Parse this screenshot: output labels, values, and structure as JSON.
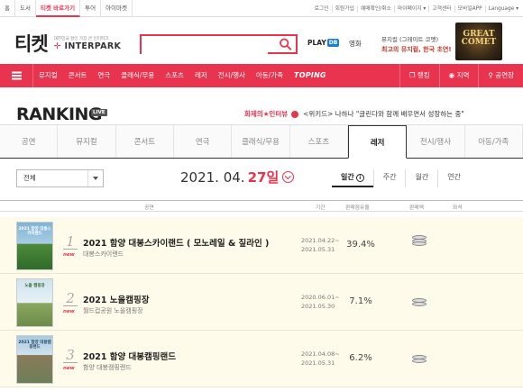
{
  "topbar": {
    "tabs": [
      {
        "label": "홈",
        "active": false
      },
      {
        "label": "도서",
        "active": false
      },
      {
        "label": "티켓 바로가기",
        "active": true
      },
      {
        "label": "투어",
        "active": false
      },
      {
        "label": "아이마켓",
        "active": false
      }
    ],
    "links": [
      "로그인",
      "회원가입",
      "예매확인/취소",
      "마이페이지 ▾",
      "고객센터",
      "모바일APP",
      "Language ▾"
    ]
  },
  "header": {
    "logo_kr": "티켓",
    "logo_small": "대한민국 할인 가장 큰 인터파크",
    "logo_en_prefix": "",
    "logo_en": "INTERPARK",
    "search_placeholder": "",
    "playdb": "PLAY",
    "playdb_badge": "DB",
    "movie": "영화",
    "promo_line1": "뮤지컬 (그레이트 코멧)",
    "promo_line2": "최고의 뮤지컬, 한국 초연!",
    "promo_image_text": "GREAT COMET"
  },
  "nav": {
    "items": [
      "뮤지컬",
      "콘서트",
      "연극",
      "클래식/무용",
      "스포츠",
      "레저",
      "전시/행사",
      "아동/가족",
      "TOPING"
    ],
    "right": [
      {
        "icon": "bookmark-icon",
        "label": "랭킹"
      },
      {
        "icon": "location-icon",
        "label": "지역"
      },
      {
        "icon": "pin-icon",
        "label": "공연장"
      }
    ]
  },
  "ranking": {
    "title": "RANKING",
    "live": "LIVE",
    "banner_brand": "화제의★인터뷰",
    "banner_text": "<위키드> 나하나 \"글린다와 함께 배우면서 성장하는 중\""
  },
  "category_tabs": [
    "공연",
    "뮤지컬",
    "콘서트",
    "연극",
    "클래식/무용",
    "스포츠",
    "레저",
    "전시/행사",
    "아동/가족"
  ],
  "active_category_index": 6,
  "filter": {
    "select_value": "전체",
    "date_prefix": "2021. 04.",
    "date_day": "27일",
    "periods": [
      "일간",
      "주간",
      "월간",
      "연간"
    ],
    "active_period_index": 0
  },
  "table_headers": {
    "performance": "공연",
    "period": "기간",
    "share": "판매점유율",
    "sales": "판매액",
    "seats": "좌석"
  },
  "rows": [
    {
      "rank": "1",
      "new": "new",
      "title": "2021 함양 대봉스카이랜드 ( 모노레일 & 짚라인 )",
      "venue": "대봉스카이랜드",
      "period_start": "2021.04.22~",
      "period_end": "2021.05.31",
      "share": "39.4%",
      "coins": 3,
      "poster_text": "2021 함양 대봉스카이랜드",
      "poster_colors": [
        "#7fb3d5",
        "#4e8a3a"
      ]
    },
    {
      "rank": "2",
      "new": "new",
      "title": "2021 노을캠핑장",
      "venue": "월드컵공원 노을캠핑장",
      "period_start": "2020.06.01~",
      "period_end": "2021.05.30",
      "share": "7.1%",
      "coins": 2,
      "poster_text": "노을 캠핑장",
      "poster_colors": [
        "#cfe3f0",
        "#6e8c4a"
      ]
    },
    {
      "rank": "3",
      "new": "new",
      "title": "2021 함양 대봉캠핑랜드",
      "venue": "함양 대봉캠핑랜드",
      "period_start": "2021.04.08~",
      "period_end": "2021.05.31",
      "share": "6.2%",
      "coins": 2,
      "poster_text": "2021 함양 대봉캠핑랜드",
      "poster_colors": [
        "#a9cbe0",
        "#6d7f58"
      ]
    }
  ],
  "colors": {
    "accent": "#e8344e",
    "row_bg": "#fffbea"
  }
}
